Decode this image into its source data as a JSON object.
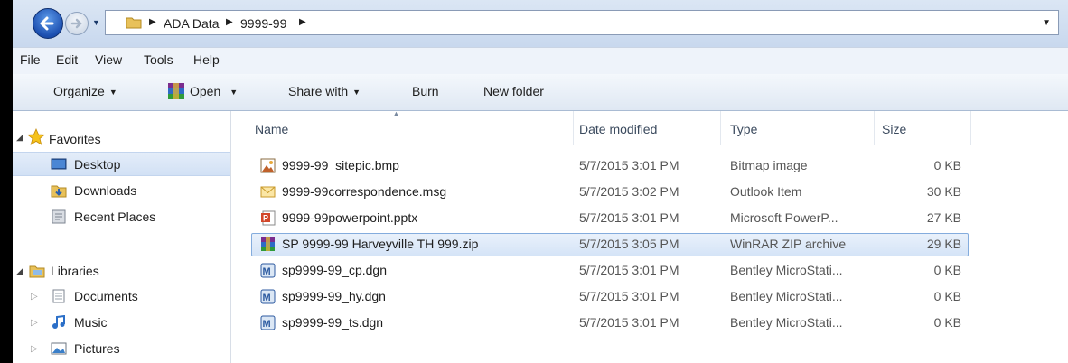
{
  "address": {
    "crumbs": [
      "ADA Data",
      "9999-99"
    ]
  },
  "menu": [
    "File",
    "Edit",
    "View",
    "Tools",
    "Help"
  ],
  "toolbar": {
    "organize": "Organize",
    "open": "Open",
    "share_with": "Share with",
    "burn": "Burn",
    "new_folder": "New folder"
  },
  "nav": {
    "favorites": "Favorites",
    "desktop": "Desktop",
    "downloads": "Downloads",
    "recent_places": "Recent Places",
    "libraries": "Libraries",
    "documents": "Documents",
    "music": "Music",
    "pictures": "Pictures"
  },
  "columns": {
    "name": "Name",
    "date_modified": "Date modified",
    "type": "Type",
    "size": "Size"
  },
  "files": [
    {
      "name": "9999-99_sitepic.bmp",
      "date": "5/7/2015 3:01 PM",
      "type": "Bitmap image",
      "size": "0 KB",
      "icon": "bitmap-icon"
    },
    {
      "name": "9999-99correspondence.msg",
      "date": "5/7/2015 3:02 PM",
      "type": "Outlook Item",
      "size": "30 KB",
      "icon": "mail-icon"
    },
    {
      "name": "9999-99powerpoint.pptx",
      "date": "5/7/2015 3:01 PM",
      "type": "Microsoft PowerP...",
      "size": "27 KB",
      "icon": "powerpoint-icon"
    },
    {
      "name": "SP 9999-99 Harveyville TH 999.zip",
      "date": "5/7/2015 3:05 PM",
      "type": "WinRAR ZIP archive",
      "size": "29 KB",
      "icon": "winrar-icon"
    },
    {
      "name": "sp9999-99_cp.dgn",
      "date": "5/7/2015 3:01 PM",
      "type": "Bentley MicroStati...",
      "size": "0 KB",
      "icon": "microstation-icon"
    },
    {
      "name": "sp9999-99_hy.dgn",
      "date": "5/7/2015 3:01 PM",
      "type": "Bentley MicroStati...",
      "size": "0 KB",
      "icon": "microstation-icon"
    },
    {
      "name": "sp9999-99_ts.dgn",
      "date": "5/7/2015 3:01 PM",
      "type": "Bentley MicroStati...",
      "size": "0 KB",
      "icon": "microstation-icon"
    }
  ],
  "selected_file_index": 3
}
